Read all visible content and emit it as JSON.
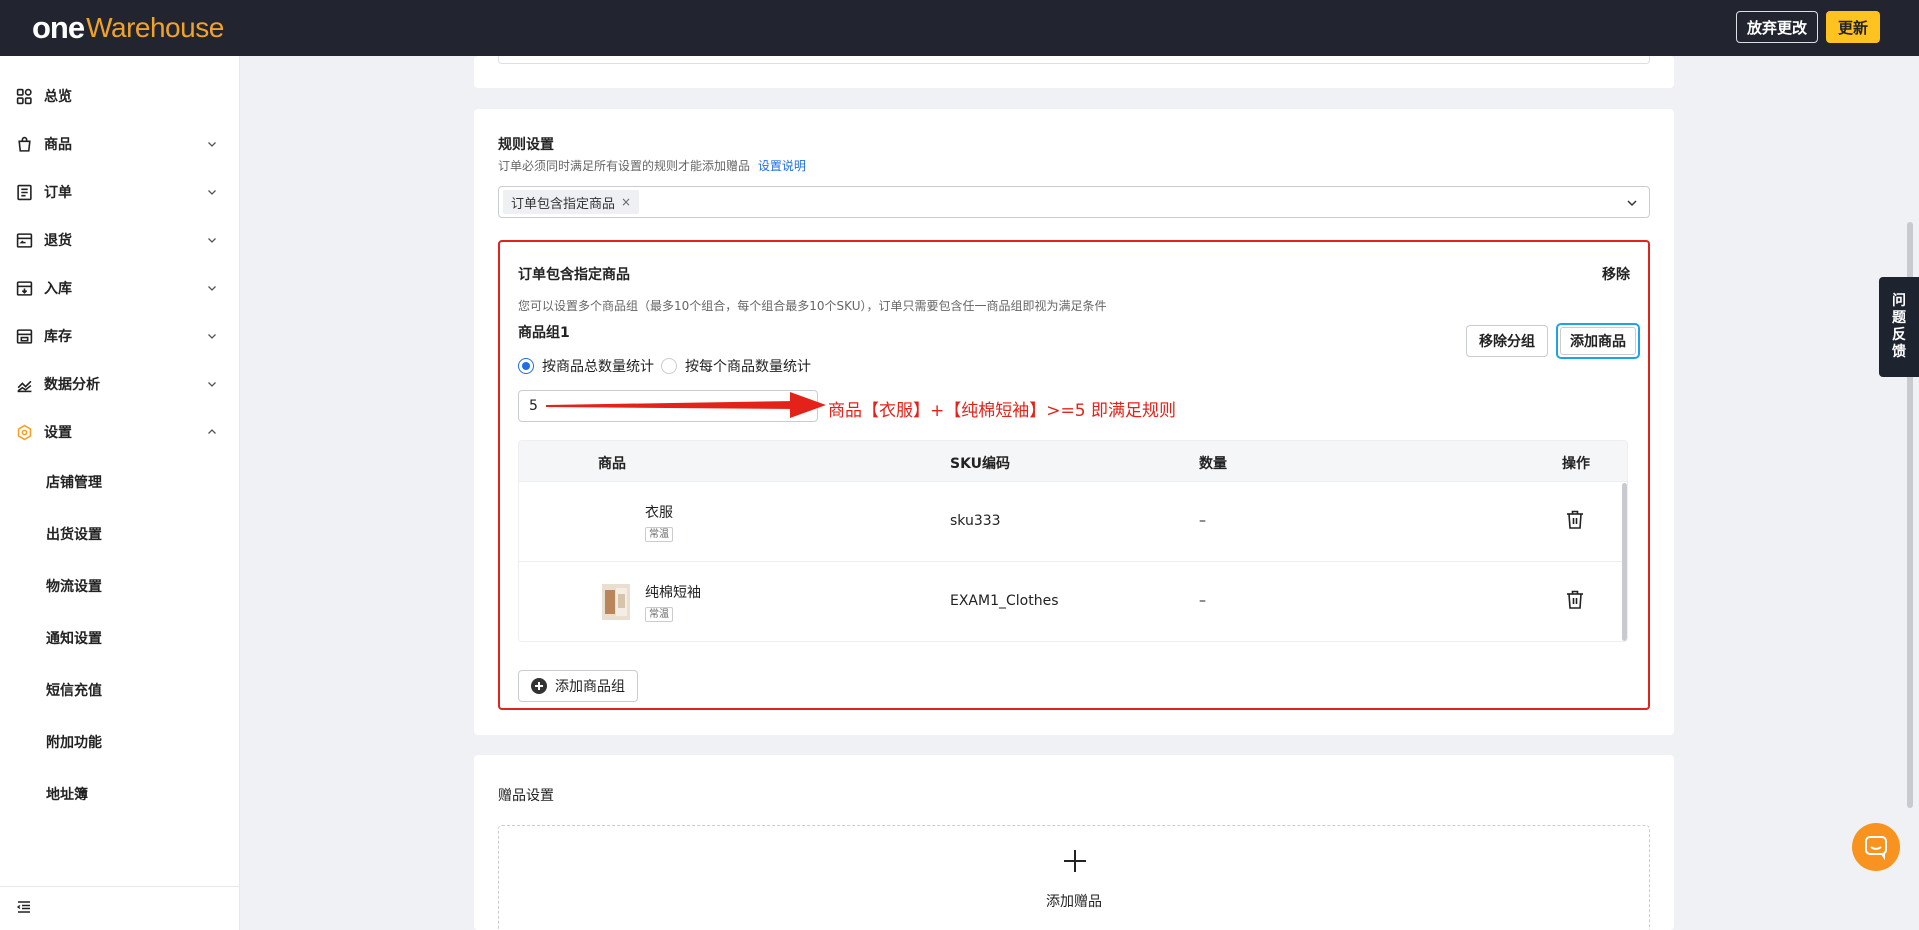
{
  "header": {
    "logo_one": "one",
    "logo_warehouse": "Warehouse",
    "discard_label": "放弃更改",
    "update_label": "更新"
  },
  "sidebar": {
    "items": [
      {
        "label": "总览",
        "icon": "dashboard-icon"
      },
      {
        "label": "商品",
        "icon": "product-icon"
      },
      {
        "label": "订单",
        "icon": "order-icon"
      },
      {
        "label": "退货",
        "icon": "return-icon"
      },
      {
        "label": "入库",
        "icon": "inbound-icon"
      },
      {
        "label": "库存",
        "icon": "inventory-icon"
      },
      {
        "label": "数据分析",
        "icon": "analytics-icon"
      },
      {
        "label": "设置",
        "icon": "settings-icon"
      }
    ],
    "sub_items": [
      "店铺管理",
      "出货设置",
      "物流设置",
      "通知设置",
      "短信充值",
      "附加功能",
      "地址簿"
    ]
  },
  "rules": {
    "title": "规则设置",
    "desc": "订单必须同时满足所有设置的规则才能添加赠品",
    "desc_link": "设置说明",
    "selected_tag": "订单包含指定商品",
    "tag_close": "×",
    "block": {
      "title": "订单包含指定商品",
      "remove": "移除",
      "desc": "您可以设置多个商品组（最多10个组合，每个组合最多10个SKU），订单只需要包含任一商品组即视为满足条件",
      "group_title": "商品组1",
      "remove_group": "移除分组",
      "add_product": "添加商品",
      "radio_total": "按商品总数量统计",
      "radio_each": "按每个商品数量统计",
      "quantity": "5",
      "annotation": "商品【衣服】+【纯棉短袖】>=5 即满足规则",
      "table": {
        "headers": [
          "商品",
          "SKU编码",
          "数量",
          "操作"
        ],
        "rows": [
          {
            "name": "衣服",
            "tag": "常温",
            "sku": "sku333",
            "qty": "–"
          },
          {
            "name": "纯棉短袖",
            "tag": "常温",
            "sku": "EXAM1_Clothes",
            "qty": "–"
          }
        ]
      },
      "add_group": "添加商品组"
    }
  },
  "gift": {
    "title": "赠品设置",
    "add_label": "添加赠品"
  },
  "feedback": [
    "问",
    "题",
    "反",
    "馈"
  ],
  "colors": {
    "accent": "#ffc31f",
    "highlight_border": "#e3231a",
    "link": "#1f6fe5",
    "topbar": "#222530",
    "logo_orange": "#f0a22a",
    "chat": "#f7931e"
  }
}
